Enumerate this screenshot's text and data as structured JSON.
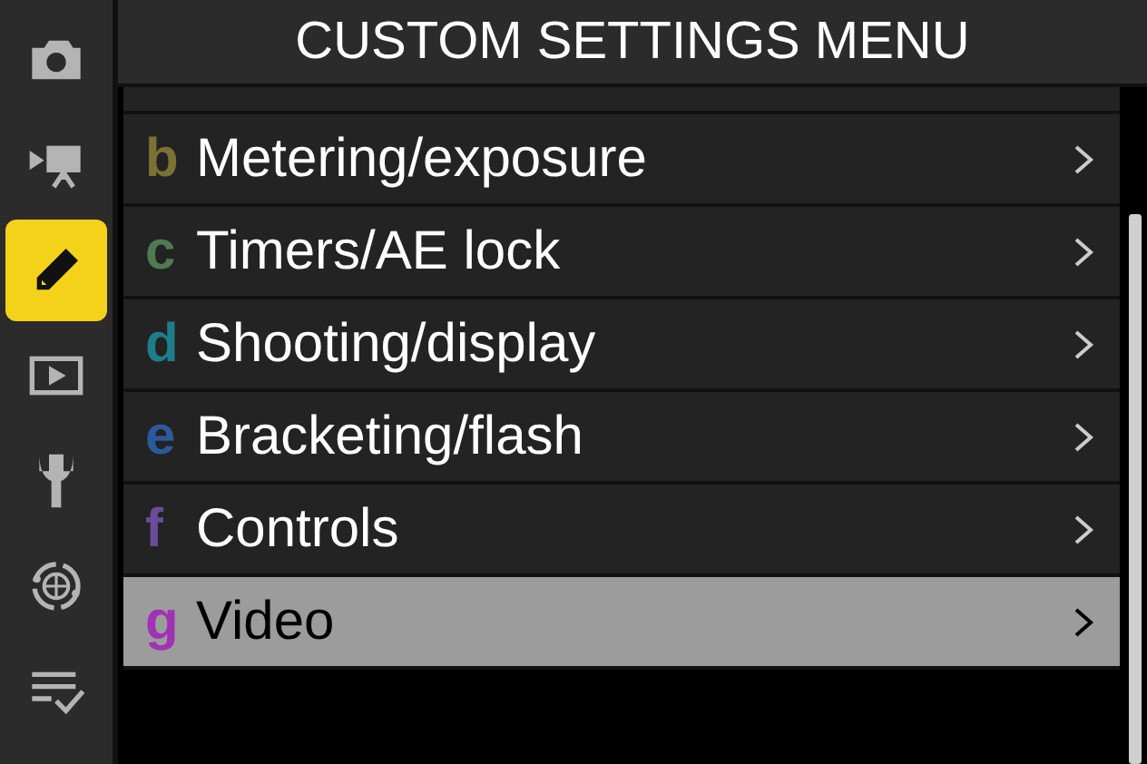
{
  "sidebar": {
    "items": [
      {
        "kind": "camera",
        "selected": false
      },
      {
        "kind": "video",
        "selected": false
      },
      {
        "kind": "pencil",
        "selected": true
      },
      {
        "kind": "playback",
        "selected": false
      },
      {
        "kind": "wrench",
        "selected": false
      },
      {
        "kind": "network",
        "selected": false
      },
      {
        "kind": "checklist",
        "selected": false
      }
    ]
  },
  "window": {
    "title": "CUSTOM SETTINGS MENU"
  },
  "menu": {
    "items": [
      {
        "letter": "b",
        "label": "Metering/exposure",
        "color": "#7a7232",
        "selected": false
      },
      {
        "letter": "c",
        "label": "Timers/AE lock",
        "color": "#4f7a52",
        "selected": false
      },
      {
        "letter": "d",
        "label": "Shooting/display",
        "color": "#1e7d8a",
        "selected": false
      },
      {
        "letter": "e",
        "label": "Bracketing/flash",
        "color": "#2b5a9c",
        "selected": false
      },
      {
        "letter": "f",
        "label": "Controls",
        "color": "#6a4c9c",
        "selected": false
      },
      {
        "letter": "g",
        "label": "Video",
        "color": "#a032b4",
        "selected": true
      }
    ]
  }
}
